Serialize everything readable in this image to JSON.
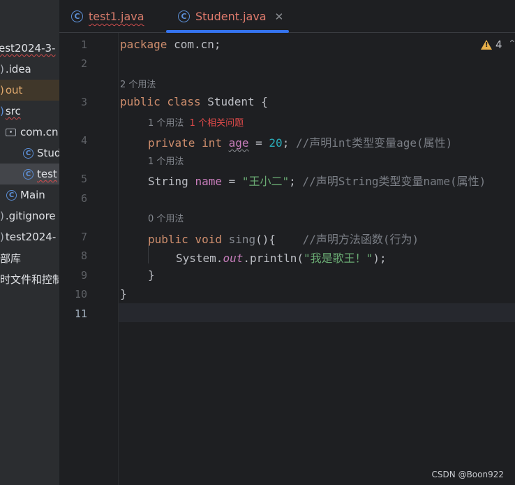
{
  "sidebar": {
    "items": [
      {
        "label": "est2024-3-"
      },
      {
        "label": ".idea"
      },
      {
        "label": "out"
      },
      {
        "label": "src"
      },
      {
        "label": "com.cn"
      },
      {
        "label": "Stud"
      },
      {
        "label": "test"
      },
      {
        "label": "Main"
      },
      {
        "label": ".gitignore"
      },
      {
        "label": "test2024-"
      },
      {
        "label": "部库"
      },
      {
        "label": "时文件和控制"
      }
    ]
  },
  "tabs": [
    {
      "label": "test1.java"
    },
    {
      "label": "Student.java",
      "close": "✕"
    }
  ],
  "editor": {
    "line_numbers": [
      "1",
      "2",
      "3",
      "4",
      "5",
      "6",
      "7",
      "8",
      "9",
      "10",
      "11"
    ],
    "warnings_count": "4",
    "hints": {
      "class_usages": "2 个用法",
      "age_usages": "1 个用法",
      "age_problems": "1 个相关问题",
      "name_usages": "1 个用法",
      "sing_usages": "0 个用法"
    },
    "code": {
      "l1_kw": "package",
      "l1_rest": " com.cn;",
      "l3_kw": "public class",
      "l3_rest": " Student {",
      "l4_kw": "private int",
      "l4_field": "age",
      "l4_eq": " = ",
      "l4_num": "20",
      "l4_semi": ";",
      "l4_comment": " //声明int类型变量age(属性)",
      "l5_type": "String",
      "l5_field": "name",
      "l5_eq": " = ",
      "l5_str": "\"王小二\"",
      "l5_semi": ";",
      "l5_comment": " //声明String类型变量name(属性)",
      "l7_kw": "public void",
      "l7_method": "sing",
      "l7_rest": "(){",
      "l7_comment": "    //声明方法函数(行为)",
      "l8_a": "System.",
      "l8_out": "out",
      "l8_b": ".println(",
      "l8_str": "\"我是歌王！\"",
      "l8_c": ");",
      "l9": "}",
      "l10": "}"
    }
  },
  "watermark": "CSDN @Boon922"
}
